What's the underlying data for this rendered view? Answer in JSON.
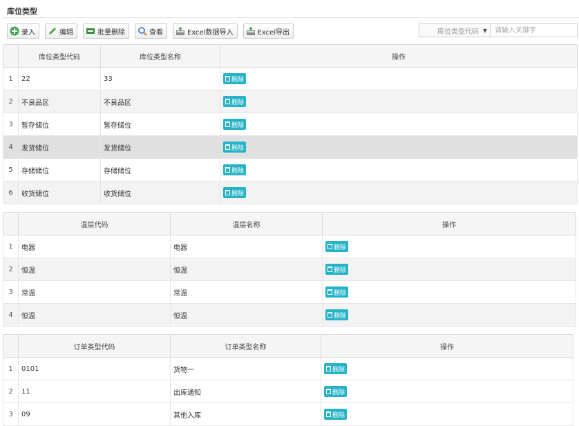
{
  "panel": {
    "title": "库位类型"
  },
  "toolbar": {
    "add": "录入",
    "edit": "编辑",
    "batch_delete": "批量删除",
    "view": "查看",
    "excel_import": "Excel数据导入",
    "excel_export": "Excel导出"
  },
  "search": {
    "field": "库位类型代码",
    "placeholder": "请输入关键字"
  },
  "delete_label": "删除",
  "table1": {
    "headers": [
      "库位类型代码",
      "库位类型名称",
      "操作"
    ],
    "rows": [
      {
        "num": "1",
        "code": "22",
        "name": "33"
      },
      {
        "num": "2",
        "code": "不良品区",
        "name": "不良品区"
      },
      {
        "num": "3",
        "code": "暂存储位",
        "name": "暂存储位"
      },
      {
        "num": "4",
        "code": "发货储位",
        "name": "发货储位"
      },
      {
        "num": "5",
        "code": "存储储位",
        "name": "存储储位"
      },
      {
        "num": "6",
        "code": "收货储位",
        "name": "收货储位"
      }
    ]
  },
  "table2": {
    "headers": [
      "温层代码",
      "温层名称",
      "操作"
    ],
    "rows": [
      {
        "num": "1",
        "code": "电器",
        "name": "电器"
      },
      {
        "num": "2",
        "code": "恒温",
        "name": "恒温"
      },
      {
        "num": "3",
        "code": "常温",
        "name": "常温"
      },
      {
        "num": "4",
        "code": "恒温",
        "name": "恒温"
      }
    ]
  },
  "table3": {
    "headers": [
      "订单类型代码",
      "订单类型名称",
      "操作"
    ],
    "rows": [
      {
        "num": "1",
        "code": "0101",
        "name": "货物一"
      },
      {
        "num": "2",
        "code": "11",
        "name": "出库通知"
      },
      {
        "num": "3",
        "code": "09",
        "name": "其他入库"
      }
    ]
  }
}
